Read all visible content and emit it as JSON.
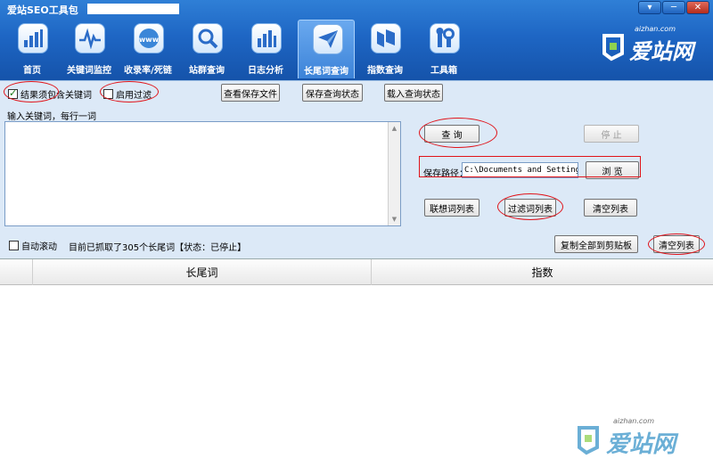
{
  "window": {
    "title": "爱站SEO工具包",
    "minimize_glyph": "▾",
    "restore_glyph": "─",
    "close_glyph": "✕"
  },
  "nav": {
    "items": [
      {
        "label": "首页",
        "icon": "home-icon"
      },
      {
        "label": "关键词监控",
        "icon": "keyword-monitor-icon"
      },
      {
        "label": "收录率/死链",
        "icon": "www-globe-icon"
      },
      {
        "label": "站群查询",
        "icon": "search-icon"
      },
      {
        "label": "日志分析",
        "icon": "log-chart-icon"
      },
      {
        "label": "长尾词查询",
        "icon": "paper-plane-icon",
        "active": true
      },
      {
        "label": "指数查询",
        "icon": "index-icon"
      },
      {
        "label": "工具箱",
        "icon": "tools-icon"
      }
    ]
  },
  "logo": {
    "sub": "aizhan.com",
    "main": "爱站网"
  },
  "options": {
    "must_contain_keyword": "结果须包含关键词",
    "must_contain_checked": true,
    "enable_filter": "启用过滤",
    "enable_filter_checked": false,
    "view_saved_file": "查看保存文件",
    "save_query_state": "保存查询状态",
    "load_query_state": "载入查询状态"
  },
  "input": {
    "label": "输入关键词，每行一词",
    "value": ""
  },
  "actions": {
    "query": "查  询",
    "stop": "停  止",
    "save_path_label": "保存路径：",
    "save_path_value": "C:\\Documents and Settings",
    "browse": "浏  览",
    "suggest_list": "联想词列表",
    "filter_list": "过滤词列表",
    "clear_list": "清空列表",
    "copy_all": "复制全部到剪贴板",
    "clear_results": "清空列表"
  },
  "status": {
    "auto_scroll": "自动滚动",
    "auto_scroll_checked": false,
    "text": "目前已抓取了305个长尾词【状态：已停止】"
  },
  "table": {
    "columns": [
      "长尾词",
      "指数"
    ],
    "rows": []
  },
  "watermark": {
    "sub": "aizhan.com",
    "main": "爱站网"
  },
  "colors": {
    "header_blue": "#1e66c4",
    "panel_bg": "#dce9f7",
    "annotation_red": "#e0141a",
    "watermark_blue": "#3a95c9"
  }
}
